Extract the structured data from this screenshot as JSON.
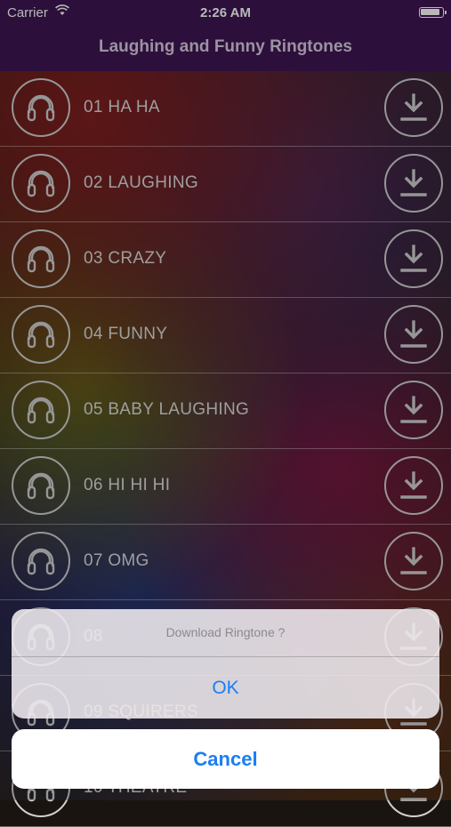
{
  "status_bar": {
    "carrier": "Carrier",
    "time": "2:26 AM",
    "wifi_icon": "wifi-icon",
    "battery_icon": "battery-icon"
  },
  "header": {
    "title": "Laughing and Funny Ringtones",
    "background": "#3d1652"
  },
  "ringtones": [
    {
      "label": "01 HA HA"
    },
    {
      "label": "02 LAUGHING"
    },
    {
      "label": "03 CRAZY"
    },
    {
      "label": "04 FUNNY"
    },
    {
      "label": "05 BABY LAUGHING"
    },
    {
      "label": "06 HI HI HI"
    },
    {
      "label": "07 OMG"
    },
    {
      "label": "08"
    },
    {
      "label": "09 SQUIRERS"
    },
    {
      "label": "10 THEATRE"
    }
  ],
  "row_icons": {
    "leading": "headphones-icon",
    "trailing": "download-icon"
  },
  "action_sheet": {
    "message": "Download Ringtone ?",
    "ok_label": "OK",
    "cancel_label": "Cancel",
    "accent": "#1a7ef5"
  }
}
